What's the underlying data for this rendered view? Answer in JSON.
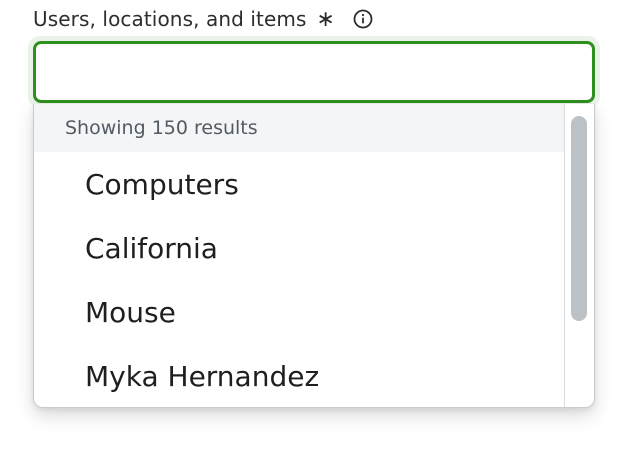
{
  "field": {
    "label": "Users, locations, and items",
    "required_marker": "∗",
    "info_icon": "info-icon",
    "value": ""
  },
  "dropdown": {
    "results_text": "Showing 150 results",
    "options": [
      {
        "label": "Computers"
      },
      {
        "label": "California"
      },
      {
        "label": "Mouse"
      },
      {
        "label": "Myka Hernandez"
      }
    ]
  },
  "colors": {
    "focus_border": "#2f8f1f",
    "focus_glow": "#e9f3e8",
    "header_bg": "#f4f5f6",
    "scroll_thumb": "#bcc1c6"
  }
}
